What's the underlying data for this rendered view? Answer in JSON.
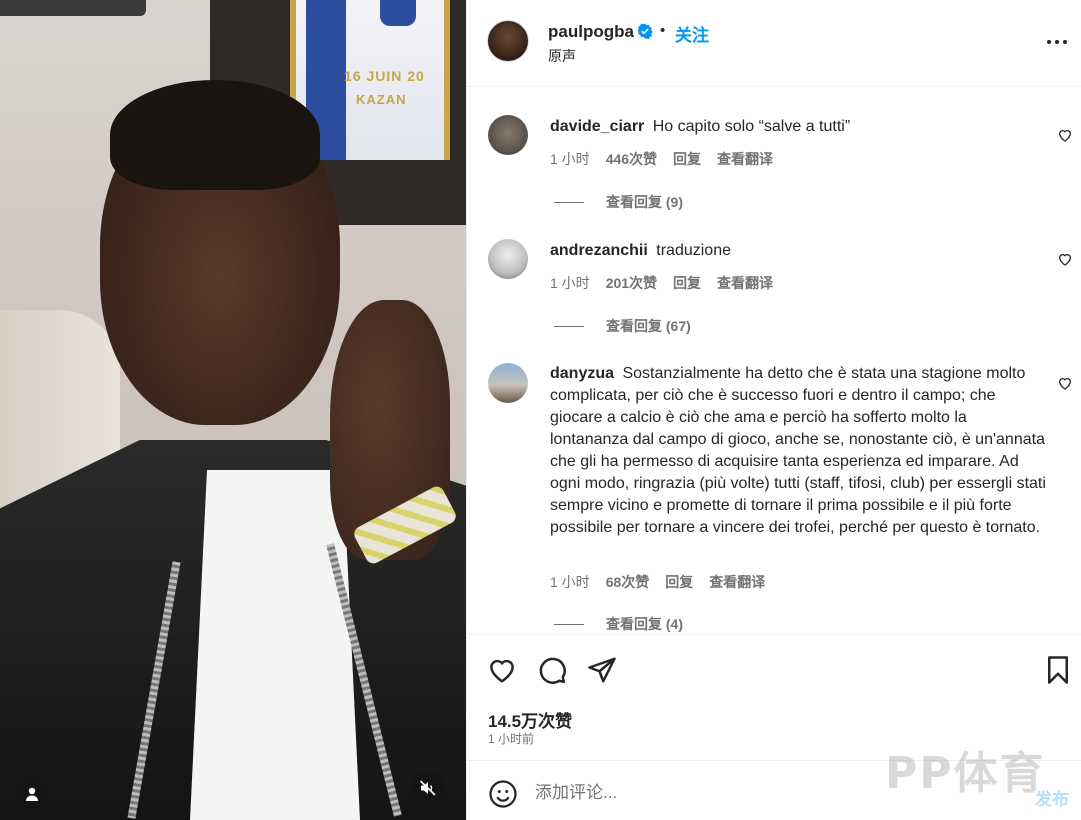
{
  "video": {
    "pennant_line1": "16 JUIN 20",
    "pennant_line2": "KAZAN"
  },
  "post": {
    "username": "paulpogba",
    "verified": true,
    "separator": "•",
    "follow_label": "关注",
    "audio_label": "原声"
  },
  "comments": [
    {
      "username": "davide_ciarr",
      "text": "Ho capito solo “salve a tutti”",
      "time": "1 小时",
      "likes": "446次赞",
      "reply_label": "回复",
      "translate_label": "查看翻译",
      "view_replies": "查看回复 (9)"
    },
    {
      "username": "andrezanchii",
      "text": "traduzione",
      "time": "1 小时",
      "likes": "201次赞",
      "reply_label": "回复",
      "translate_label": "查看翻译",
      "view_replies": "查看回复 (67)"
    },
    {
      "username": "danyzua",
      "text": "Sostanzialmente ha detto che è stata una stagione molto complicata, per ciò che è successo fuori e dentro il campo; che giocare a calcio è ciò che ama e perciò ha sofferto molto la lontananza dal campo di gioco, anche se, nonostante ciò, è un'annata che gli ha permesso di acquisire tanta esperienza ed imparare. Ad ogni modo, ringrazia (più volte) tutti (staff, tifosi, club) per essergli stati sempre vicino e promette di tornare il prima possibile e il più forte possibile per tornare a vincere dei trofei, perché per questo è tornato.",
      "time": "1 小时",
      "likes": "68次赞",
      "reply_label": "回复",
      "translate_label": "查看翻译",
      "view_replies": "查看回复 (4)"
    }
  ],
  "actions": {
    "likes_count": "14.5万次赞",
    "timestamp": "1 小时前"
  },
  "composer": {
    "placeholder": "添加评论...",
    "post_label": "发布"
  },
  "watermark": "PP体育",
  "colors": {
    "accent": "#0095f6",
    "text": "#262626",
    "muted": "#737373",
    "post_disabled": "#b2dffc"
  }
}
